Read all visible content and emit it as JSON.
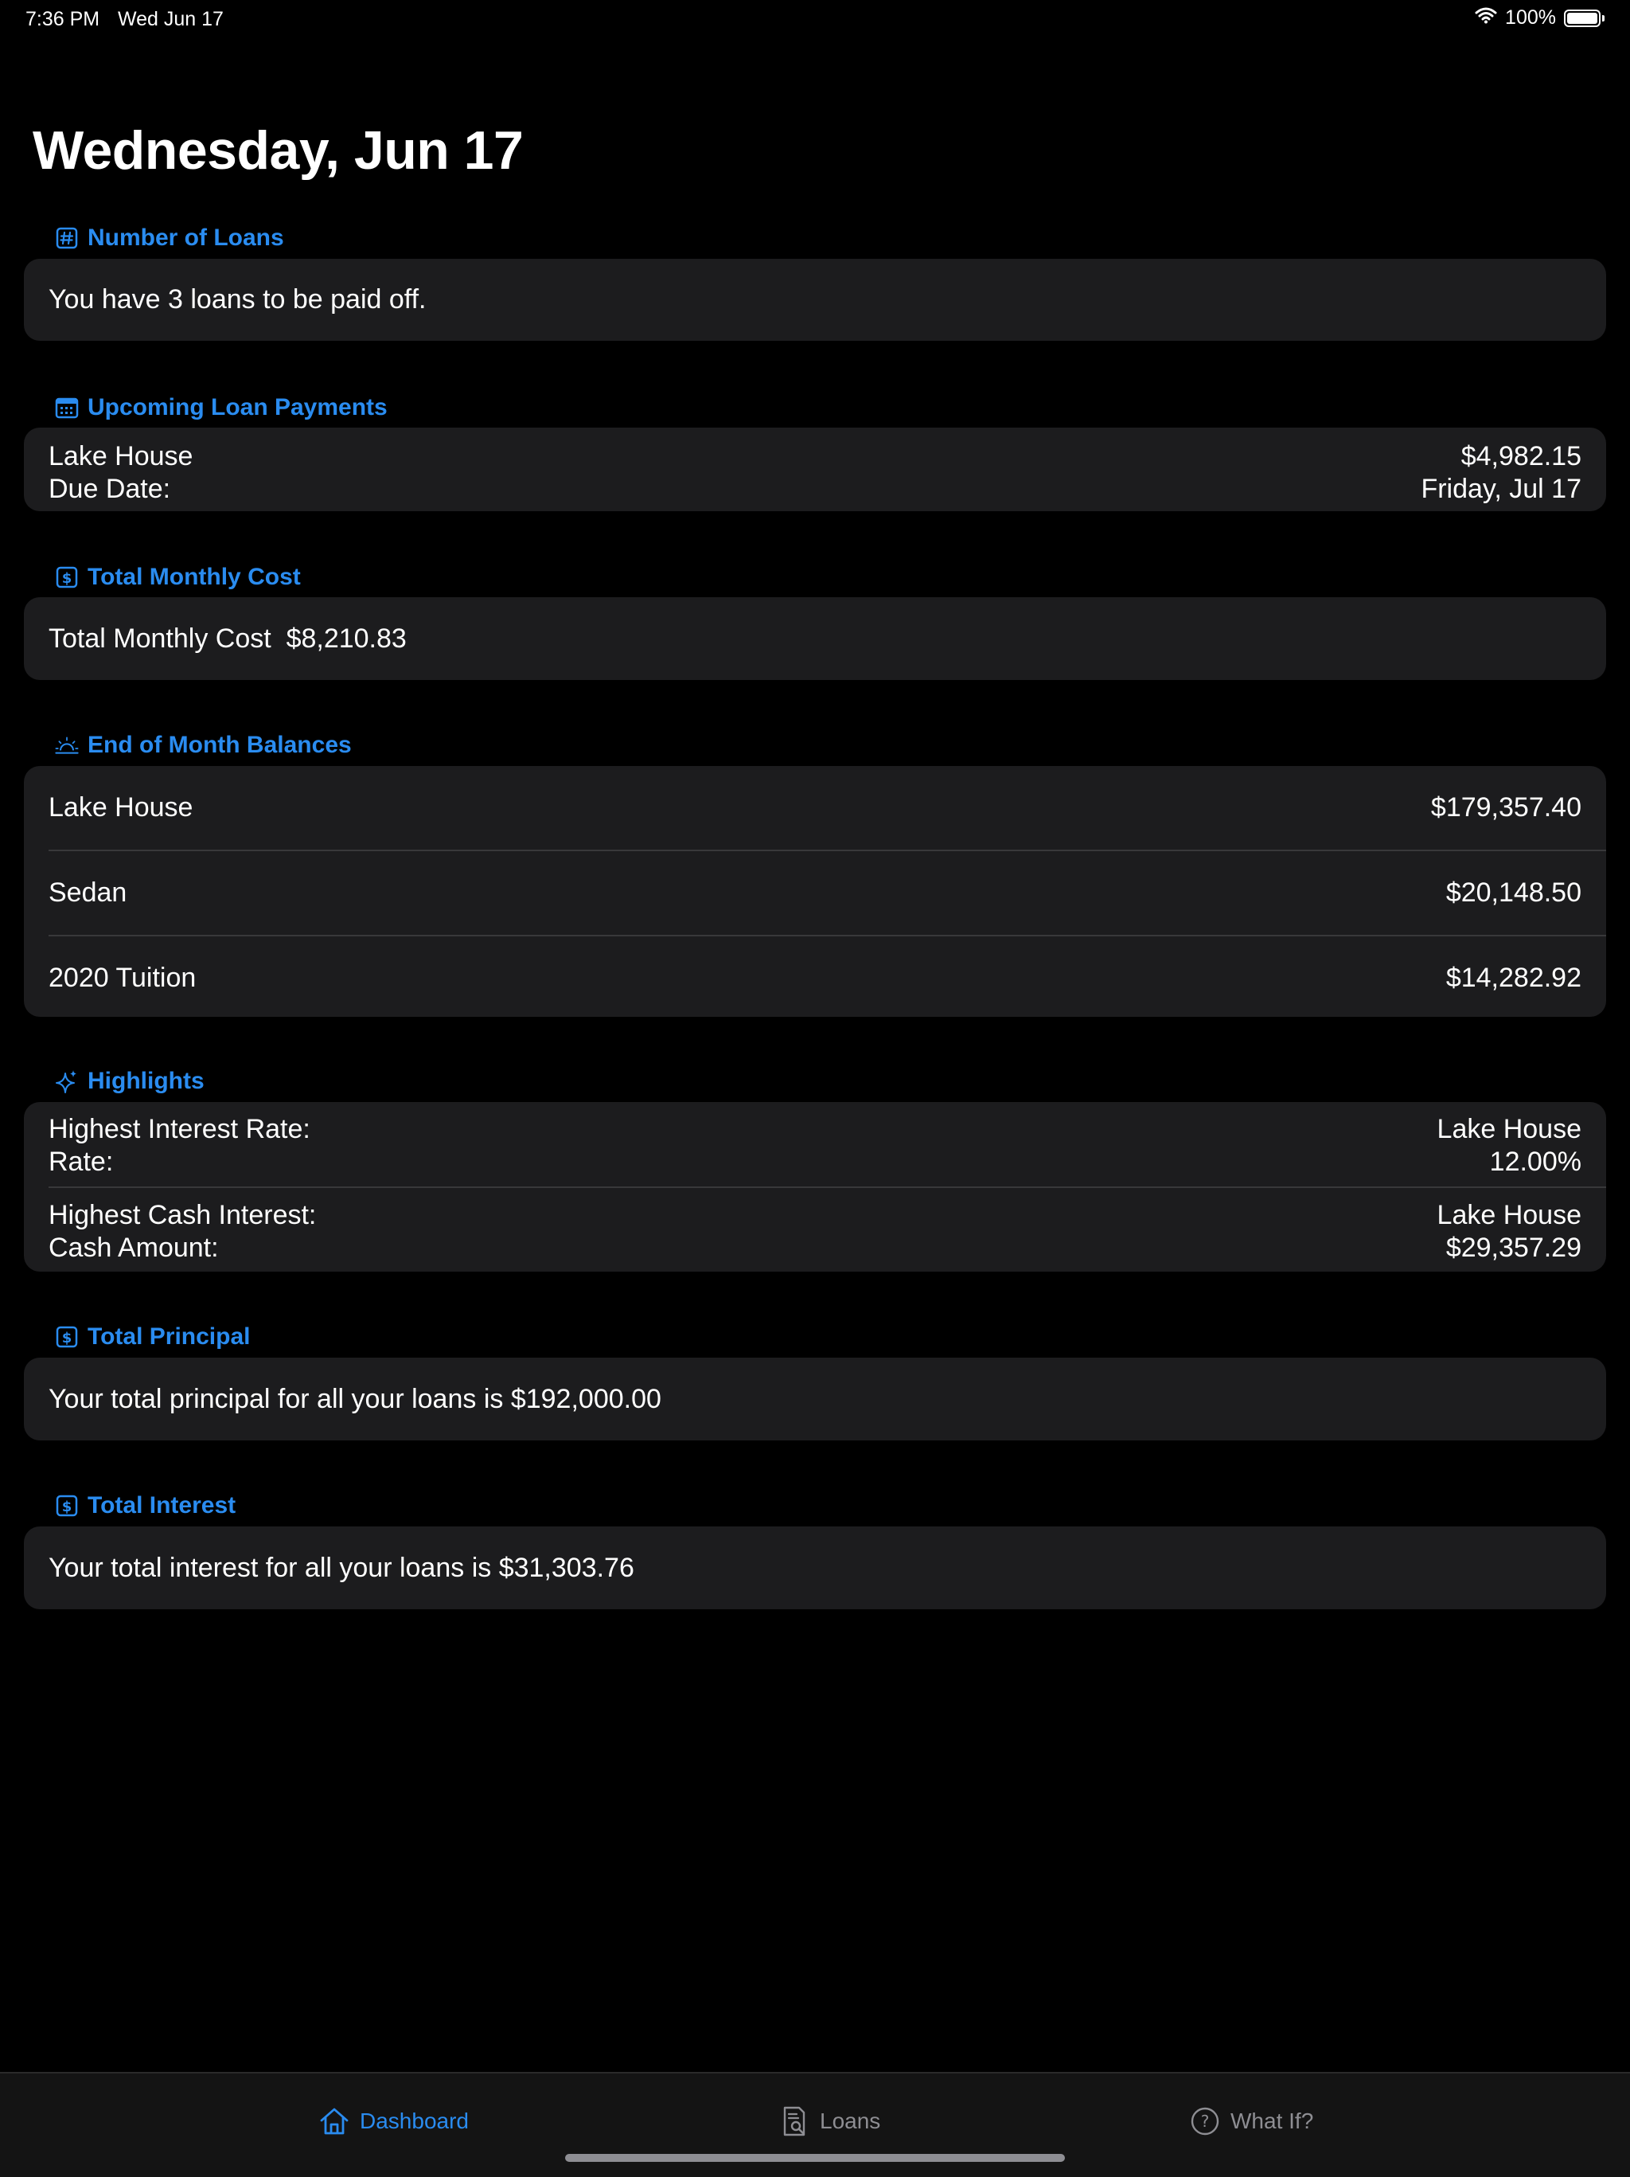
{
  "status": {
    "time": "7:36 PM",
    "date": "Wed Jun 17",
    "battery": "100%"
  },
  "title": "Wednesday, Jun 17",
  "sections": {
    "number_of_loans": {
      "header": "Number of Loans",
      "text": "You have 3 loans to be paid off."
    },
    "upcoming": {
      "header": "Upcoming Loan Payments",
      "name": "Lake House",
      "amount": "$4,982.15",
      "due_label": "Due Date:",
      "due_value": "Friday, Jul 17"
    },
    "monthly_cost": {
      "header": "Total Monthly Cost",
      "text": "Total Monthly Cost  $8,210.83"
    },
    "balances": {
      "header": "End of Month Balances",
      "rows": [
        {
          "name": "Lake House",
          "value": "$179,357.40"
        },
        {
          "name": "Sedan",
          "value": "$20,148.50"
        },
        {
          "name": "2020 Tuition",
          "value": "$14,282.92"
        }
      ]
    },
    "highlights": {
      "header": "Highlights",
      "rows": [
        {
          "label1": "Highest Interest Rate:",
          "value1": "Lake House",
          "label2": "Rate:",
          "value2": "12.00%"
        },
        {
          "label1": "Highest Cash Interest:",
          "value1": "Lake House",
          "label2": "Cash Amount:",
          "value2": "$29,357.29"
        }
      ]
    },
    "principal": {
      "header": "Total Principal",
      "text": "Your total principal for all your loans is $192,000.00"
    },
    "interest": {
      "header": "Total Interest",
      "text": "Your total interest for all your loans is $31,303.76"
    }
  },
  "tabs": [
    {
      "label": "Dashboard",
      "icon": "house-icon",
      "active": true
    },
    {
      "label": "Loans",
      "icon": "document-search-icon",
      "active": false
    },
    {
      "label": "What If?",
      "icon": "question-circle-icon",
      "active": false
    }
  ],
  "colors": {
    "accent": "#2a8cf0",
    "card": "#1c1c1e",
    "background": "#000000"
  }
}
